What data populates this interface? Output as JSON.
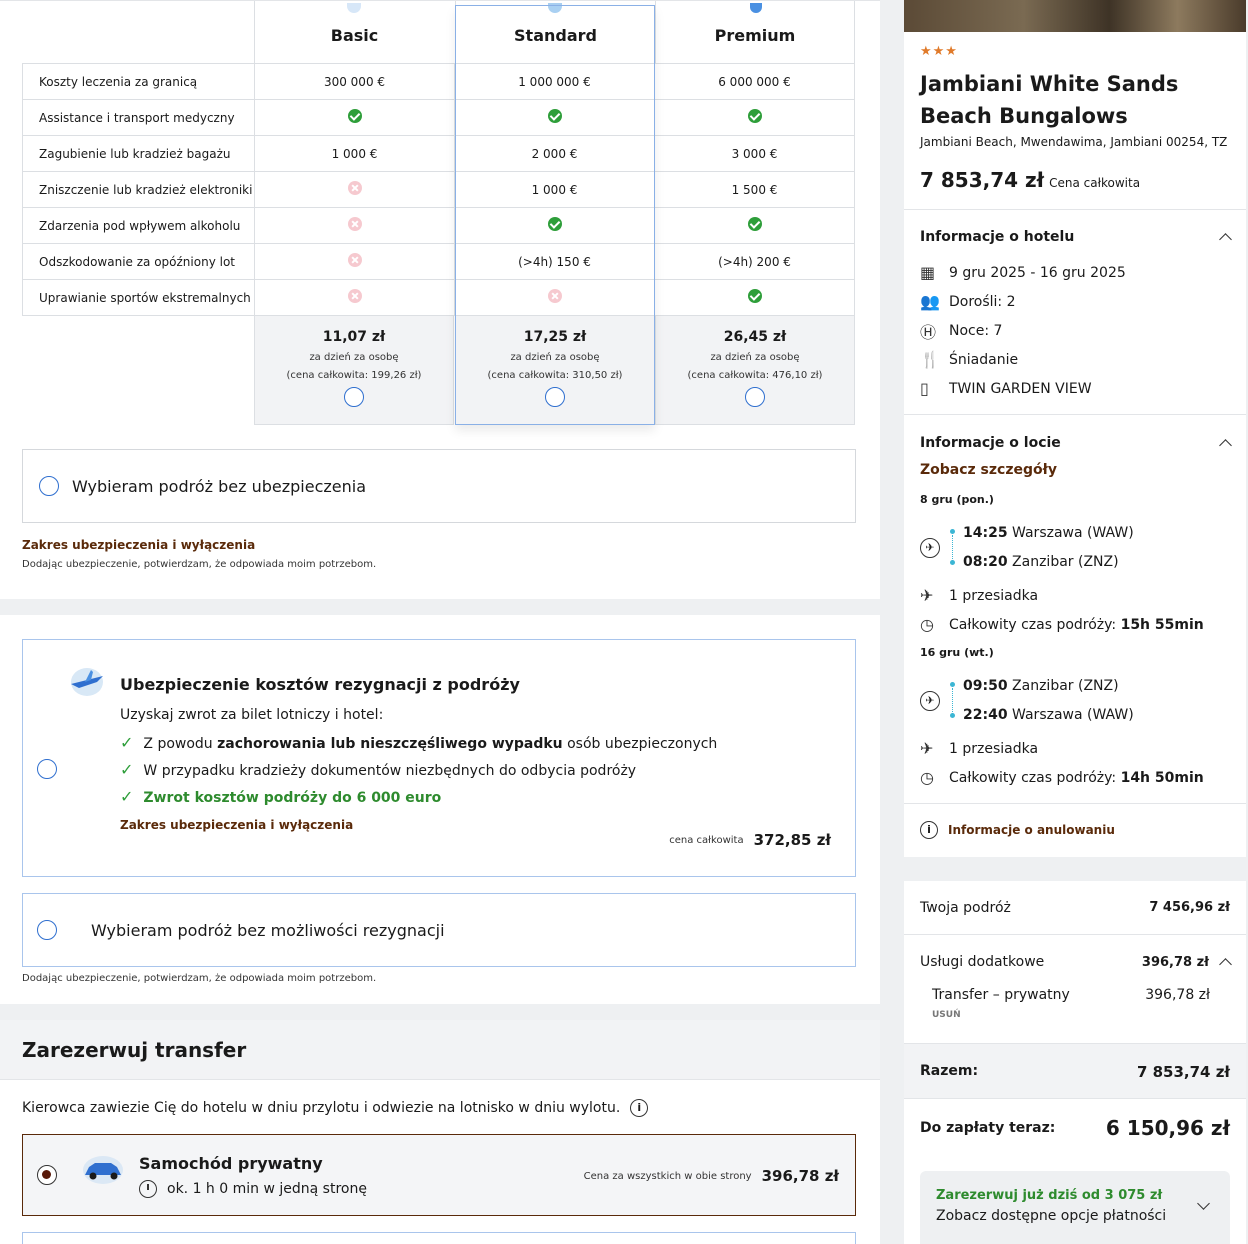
{
  "insurance_table": {
    "plans": [
      "Basic",
      "Standard",
      "Premium"
    ],
    "rows": [
      {
        "label": "Koszty leczenia za granicą",
        "values": [
          "300 000 €",
          "1 000 000 €",
          "6 000 000 €"
        ]
      },
      {
        "label": "Assistance i transport medyczny",
        "values": [
          "check",
          "check",
          "check"
        ]
      },
      {
        "label": "Zagubienie lub kradzież bagażu",
        "values": [
          "1 000 €",
          "2 000 €",
          "3 000 €"
        ]
      },
      {
        "label": "Zniszczenie lub kradzież elektroniki",
        "values": [
          "x",
          "1 000 €",
          "1 500 €"
        ]
      },
      {
        "label": "Zdarzenia pod wpływem alkoholu",
        "values": [
          "x",
          "check",
          "check"
        ]
      },
      {
        "label": "Odszkodowanie za opóźniony lot",
        "values": [
          "x",
          "(>4h) 150 €",
          "(>4h) 200 €"
        ]
      },
      {
        "label": "Uprawianie sportów ekstremalnych",
        "values": [
          "x",
          "x",
          "check"
        ]
      }
    ],
    "prices": [
      {
        "per_day": "11,07 zł",
        "per_day_label": "za dzień za osobę",
        "total": "(cena całkowita: 199,26 zł)"
      },
      {
        "per_day": "17,25 zł",
        "per_day_label": "za dzień za osobę",
        "total": "(cena całkowita: 310,50 zł)"
      },
      {
        "per_day": "26,45 zł",
        "per_day_label": "za dzień za osobę",
        "total": "(cena całkowita: 476,10 zł)"
      }
    ],
    "no_insurance_label": "Wybieram podróż bez ubezpieczenia",
    "scope_link": "Zakres ubezpieczenia i wyłączenia",
    "consent_note": "Dodając ubezpieczenie, potwierdzam, że odpowiada moim potrzebom."
  },
  "cancellation": {
    "title": "Ubezpieczenie kosztów rezygnacji z podróży",
    "subtitle": "Uzyskaj zwrot za bilet lotniczy i hotel:",
    "bullet1_pre": "Z powodu ",
    "bullet1_bold": "zachorowania lub nieszczęśliwego wypadku",
    "bullet1_post": " osób ubezpieczonych",
    "bullet2": "W przypadku kradzieży dokumentów niezbędnych do odbycia podróży",
    "bullet3": "Zwrot kosztów podróży do 6 000 euro",
    "scope_link": "Zakres ubezpieczenia i wyłączenia",
    "price_label": "cena całkowita",
    "price": "372,85 zł",
    "no_option_label": "Wybieram podróż bez możliwości rezygnacji",
    "consent_note": "Dodając ubezpieczenie, potwierdzam, że odpowiada moim potrzebom."
  },
  "transfer": {
    "title": "Zarezerwuj transfer",
    "description": "Kierowca zawiezie Cię do hotelu w dniu przylotu i odwiezie na lotnisko w dniu wylotu.",
    "option_title": "Samochód prywatny",
    "option_duration": "ok. 1 h 0 min w jedną stronę",
    "price_label": "Cena za wszystkich w obie strony",
    "price": "396,78 zł"
  },
  "hotel": {
    "stars": "★★★",
    "name": "Jambiani White Sands Beach Bungalows",
    "address": "Jambiani Beach, Mwendawima, Jambiani 00254, TZ",
    "price": "7 853,74 zł",
    "price_label": "Cena całkowita",
    "info_title": "Informacje o hotelu",
    "dates": "9 gru 2025 - 16 gru 2025",
    "adults": "Dorośli: 2",
    "nights": "Noce: 7",
    "board": "Śniadanie",
    "room": "TWIN GARDEN VIEW"
  },
  "flight": {
    "title": "Informacje o locie",
    "details_link": "Zobacz szczegóły",
    "outbound_date": "8 gru (pon.)",
    "out_dep_time": "14:25",
    "out_dep_place": "Warszawa (WAW)",
    "out_arr_time": "08:20",
    "out_arr_place": "Zanzibar (ZNZ)",
    "out_stops": "1 przesiadka",
    "out_duration_label": "Całkowity czas podróży: ",
    "out_duration": "15h 55min",
    "return_date": "16 gru (wt.)",
    "ret_dep_time": "09:50",
    "ret_dep_place": "Zanzibar (ZNZ)",
    "ret_arr_time": "22:40",
    "ret_arr_place": "Warszawa (WAW)",
    "ret_stops": "1 przesiadka",
    "ret_duration_label": "Całkowity czas podróży: ",
    "ret_duration": "14h 50min",
    "cancel_info": "Informacje o anulowaniu"
  },
  "summary": {
    "trip_label": "Twoja podróż",
    "trip_value": "7 456,96 zł",
    "extras_label": "Usługi dodatkowe",
    "extras_value": "396,78 zł",
    "transfer_label": "Transfer – prywatny",
    "transfer_value": "396,78 zł",
    "remove_label": "USUŃ",
    "total_label": "Razem:",
    "total_value": "7 853,74 zł",
    "due_label": "Do zapłaty teraz:",
    "due_value": "6 150,96 zł",
    "book_from": "Zarezerwuj już dziś od 3 075 zł",
    "payment_options": "Zobacz dostępne opcje płatności"
  }
}
